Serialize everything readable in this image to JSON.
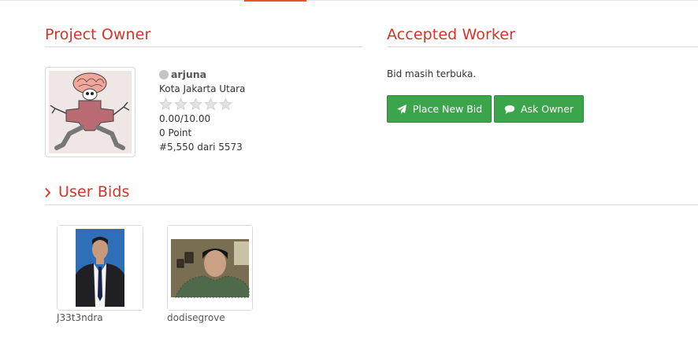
{
  "nav": {
    "active_tab_color": "#e8542e"
  },
  "owner_section": {
    "title": "Project Owner",
    "name": "arjuna",
    "status_color": "#c4c4c4",
    "location": "Kota Jakarta Utara",
    "stars_filled": 0,
    "stars_total": 5,
    "rating": "0.00/10.00",
    "points": "0 Point",
    "rank": "#5,550 dari 5573"
  },
  "worker_section": {
    "title": "Accepted Worker",
    "status": "Bid masih terbuka.",
    "place_bid_label": "Place New Bid",
    "ask_owner_label": "Ask Owner",
    "button_color": "#3aa54a"
  },
  "bids_section": {
    "title": "User Bids",
    "bidders": [
      {
        "name": "J33t3ndra"
      },
      {
        "name": "dodisegrove"
      }
    ]
  },
  "colors": {
    "accent": "#d3342a"
  }
}
